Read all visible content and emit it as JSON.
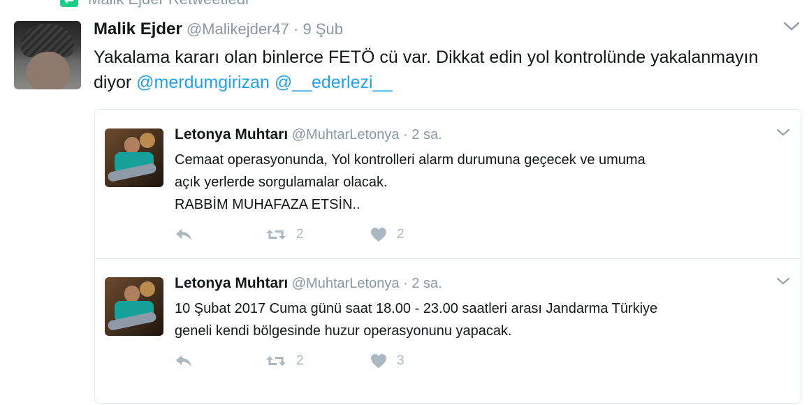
{
  "retweet_context": {
    "text": "Malik Ejder Retweetledi",
    "icon": "retweet-icon"
  },
  "main_tweet": {
    "name": "Malik Ejder",
    "handle": "@Malikejder47",
    "separator": "·",
    "time": "9 Şub",
    "text": "Yakalama kararı olan binlerce FETÖ cü var. Dikkat edin yol kontrolünde yakalanmayın diyor ",
    "mentions": [
      "@merdumgirizan",
      "@__ederlezi__"
    ]
  },
  "quoted_tweets": [
    {
      "name": "Letonya Muhtarı",
      "handle": "@MuhtarLetonya",
      "separator": "·",
      "time": "2 sa.",
      "lines": [
        "Cemaat operasyonunda, Yol kontrolleri alarm durumuna geçecek ve umuma",
        "açık yerlerde sorgulamalar olacak.",
        "RABBİM MUHAFAZA ETSİN.."
      ],
      "retweets": "2",
      "likes": "2"
    },
    {
      "name": "Letonya Muhtarı",
      "handle": "@MuhtarLetonya",
      "separator": "·",
      "time": "2 sa.",
      "lines": [
        "10 Şubat 2017 Cuma günü saat 18.00 - 23.00 saatleri arası Jandarma Türkiye",
        "geneli kendi bölgesinde huzur operasyonunu yapacak."
      ],
      "retweets": "2",
      "likes": "3"
    }
  ],
  "colors": {
    "accent": "#1da1f2",
    "muted": "#8899a6",
    "retweet_green": "#19cf86",
    "action_gray": "#aab8c2",
    "border": "#e1e8ed"
  }
}
